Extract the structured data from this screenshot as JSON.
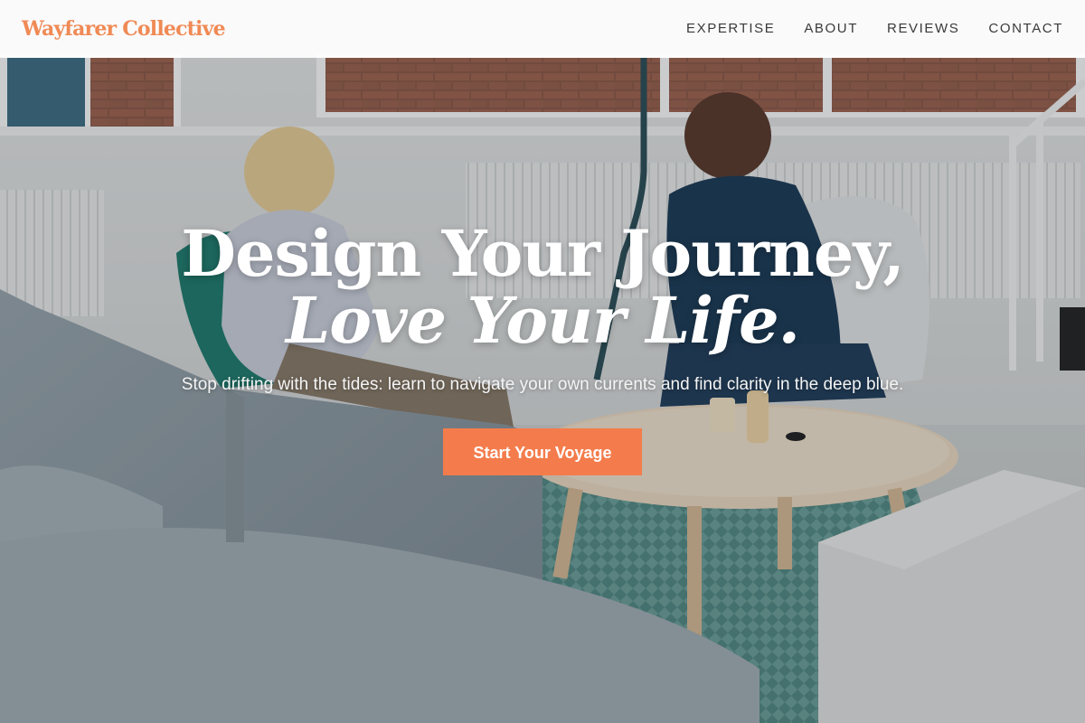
{
  "nav": {
    "brand": "Wayfarer Collective",
    "links": [
      {
        "label": "EXPERTISE"
      },
      {
        "label": "ABOUT"
      },
      {
        "label": "REVIEWS"
      },
      {
        "label": "CONTACT"
      }
    ]
  },
  "hero": {
    "headline_line1": "Design Your Journey,",
    "headline_line2": "Love Your Life.",
    "subtitle": "Stop drifting with the tides: learn to navigate your own currents and find clarity in the deep blue.",
    "cta_label": "Start Your Voyage"
  },
  "colors": {
    "brand": "#f08a55",
    "cta": "#f47c4c",
    "nav_text": "#3a3a3a"
  }
}
